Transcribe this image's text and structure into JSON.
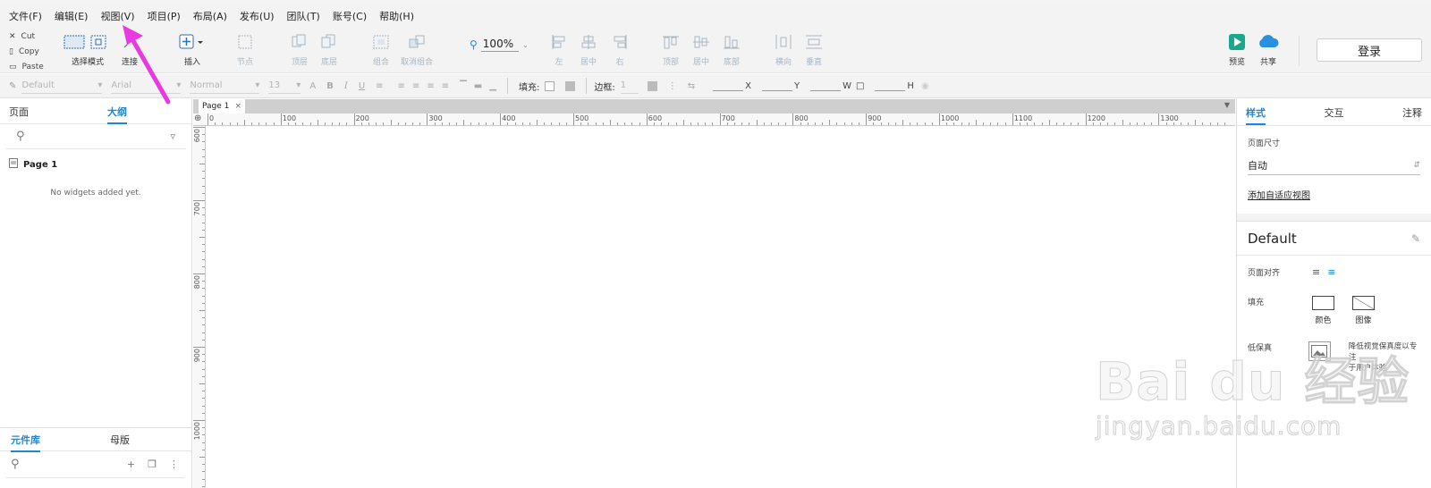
{
  "menu": [
    "文件(F)",
    "编辑(E)",
    "视图(V)",
    "项目(P)",
    "布局(A)",
    "发布(U)",
    "团队(T)",
    "账号(C)",
    "帮助(H)"
  ],
  "clipboard": {
    "cut": "Cut",
    "copy": "Copy",
    "paste": "Paste"
  },
  "toolbar": {
    "select_mode": "选择模式",
    "connect": "连接",
    "insert": "插入",
    "points": "节点",
    "top": "顶层",
    "bottom": "底层",
    "group": "组合",
    "ungroup": "取消组合",
    "zoom": "100%",
    "left": "左",
    "center": "居中",
    "right": "右",
    "align_top": "顶部",
    "align_middle": "居中",
    "align_bottom": "底部",
    "dist_h": "横向",
    "dist_v": "垂直",
    "preview": "预览",
    "share": "共享",
    "login": "登录"
  },
  "format": {
    "style": "Default",
    "font": "Arial",
    "weight": "Normal",
    "size": "13",
    "fill_label": "填充:",
    "border_label": "边框:",
    "border_value": "1",
    "x": "X",
    "y": "Y",
    "w": "W",
    "h": "H"
  },
  "left": {
    "tab_pages": "页面",
    "tab_outline": "大纲",
    "page_item": "Page 1",
    "empty": "No widgets added yet.",
    "tab_library": "元件库",
    "tab_masters": "母版"
  },
  "canvas": {
    "tab": "Page 1",
    "hruler": [
      "0",
      "100",
      "200",
      "300",
      "400",
      "500",
      "600",
      "700",
      "800",
      "900",
      "1000",
      "1100",
      "1200",
      "1300"
    ],
    "vruler": [
      "600",
      "700",
      "800",
      "900",
      "1000"
    ]
  },
  "right": {
    "tab_style": "样式",
    "tab_interact": "交互",
    "tab_notes": "注释",
    "page_size_label": "页面尺寸",
    "page_size_value": "自动",
    "adaptive_link": "添加自适应视图",
    "style_name": "Default",
    "align_label": "页面对齐",
    "fill_label": "填充",
    "fill_color": "颜色",
    "fill_image": "图像",
    "lowfi_label": "低保真",
    "lowfi_desc1": "降低视觉保真度以专注",
    "lowfi_desc2": "于用户体验"
  },
  "watermark": {
    "brand": "Bai du 经验",
    "url": "jingyan.baidu.com"
  },
  "colors": {
    "accent": "#1d87d6",
    "arrow": "#e93ae2",
    "preview": "#1aa88a",
    "share": "#2b8fe0"
  }
}
